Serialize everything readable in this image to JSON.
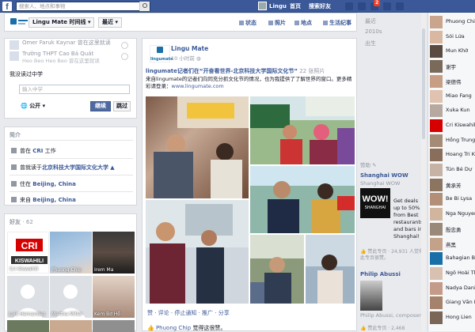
{
  "topbar": {
    "logo": "f",
    "search_placeholder": "搜索人、地点和事物",
    "profile_name": "Lingu",
    "home": "首页",
    "find_friends": "搜索好友",
    "notification_count": "2"
  },
  "timeline_bar": {
    "page_name": "Lingu Mate",
    "timeline_label": "时间线",
    "recent_label": "最近",
    "actions": [
      "状态",
      "照片",
      "地点",
      "生活纪事"
    ]
  },
  "school_card": {
    "schools": [
      {
        "name": "Omer Faruk Kaynar 曾在这里就读",
        "sub": ""
      },
      {
        "name": "Trường THPT Cao Bá Quát",
        "sub": "Heo Beo Heo Beo 曾在这里就读"
      }
    ],
    "question": "我没读过中学",
    "input_placeholder": "输入中学",
    "privacy_label": "公开",
    "continue_button": "继续",
    "skip_button": "跳过"
  },
  "intro": {
    "heading": "简介",
    "items": [
      {
        "prefix": "曾在 ",
        "link": "CRI",
        "suffix": " 工作"
      },
      {
        "prefix": "曾就读于",
        "link": "北京科技大学国际文化大学",
        "suffix": ""
      },
      {
        "prefix": "住在 ",
        "link": "Beijing, China",
        "suffix": ""
      },
      {
        "prefix": "来自 ",
        "link": "Beijing, China",
        "suffix": ""
      }
    ]
  },
  "friends": {
    "heading": "好友",
    "count": "· 62",
    "list": [
      "Cri Kiswahili",
      "Phuong Chip",
      "Irem Ma",
      "Luis Hernandez",
      "Martha Miller",
      "Kem Bơ Hồ"
    ]
  },
  "post": {
    "logo_text": "lingumate",
    "author": "Lingu Mate",
    "time": "10 小时前",
    "headline_prefix": "lingumate记者们在",
    "headline_main": "“开奋看世界-北京科技大学国际文化节”",
    "headline_suffix": " 22 张照片",
    "body": "来自lingumate的记者们向同充分抓文化节的情况，也为我提供了了解世界的窗口。更多精彩请登录：",
    "link": "www.lingumate.com",
    "actions": "赞 · 评论 · 停止通知 · 推广 · 分享",
    "liked_by": "Phuong Chip",
    "liked_suffix": " 觉得这很赞。"
  },
  "timeline_years": [
    "最近",
    "2010s",
    "出生"
  ],
  "sponsored": {
    "heading": "赞助 ✎",
    "ads": [
      {
        "title": "Shanghai WOW",
        "sub": "Shanghai WOW",
        "image_text": "WOW!",
        "image_sub": "SHANGHAI",
        "text": "Get deals up to 50% from Best restaurants and bars in Shanghai!",
        "likes": "👍 赞此专页 · 24,931 人觉得此专页很赞。"
      },
      {
        "title": "Philip Abussi",
        "sub": "Philip Abussi, composer",
        "likes": "👍 赞此专页 · 2,468"
      }
    ]
  },
  "chat_list": [
    "Phuong Chip",
    "Sói Lửa",
    "Mun Khờ",
    "谢宇",
    "梁德伟",
    "Miao Fang",
    "Xuka Kun",
    "Cri Kiswahili",
    "Hồng Trung Tâm",
    "Hoang Tri Kỳ",
    "Tún Bé Dự",
    "黄承芳",
    "Be Bi Lysa",
    "Nga Nguyen",
    "殷忠勇",
    "燕黑",
    "Bahagian Bahasa",
    "Ngô Hoài Thương",
    "Nadya Daniel",
    "Giang Văn Hiền",
    "Hong Lien"
  ],
  "colors": {
    "brand": "#3b5998",
    "accent_button": "#4e69a2",
    "badge": "#f03d25"
  }
}
